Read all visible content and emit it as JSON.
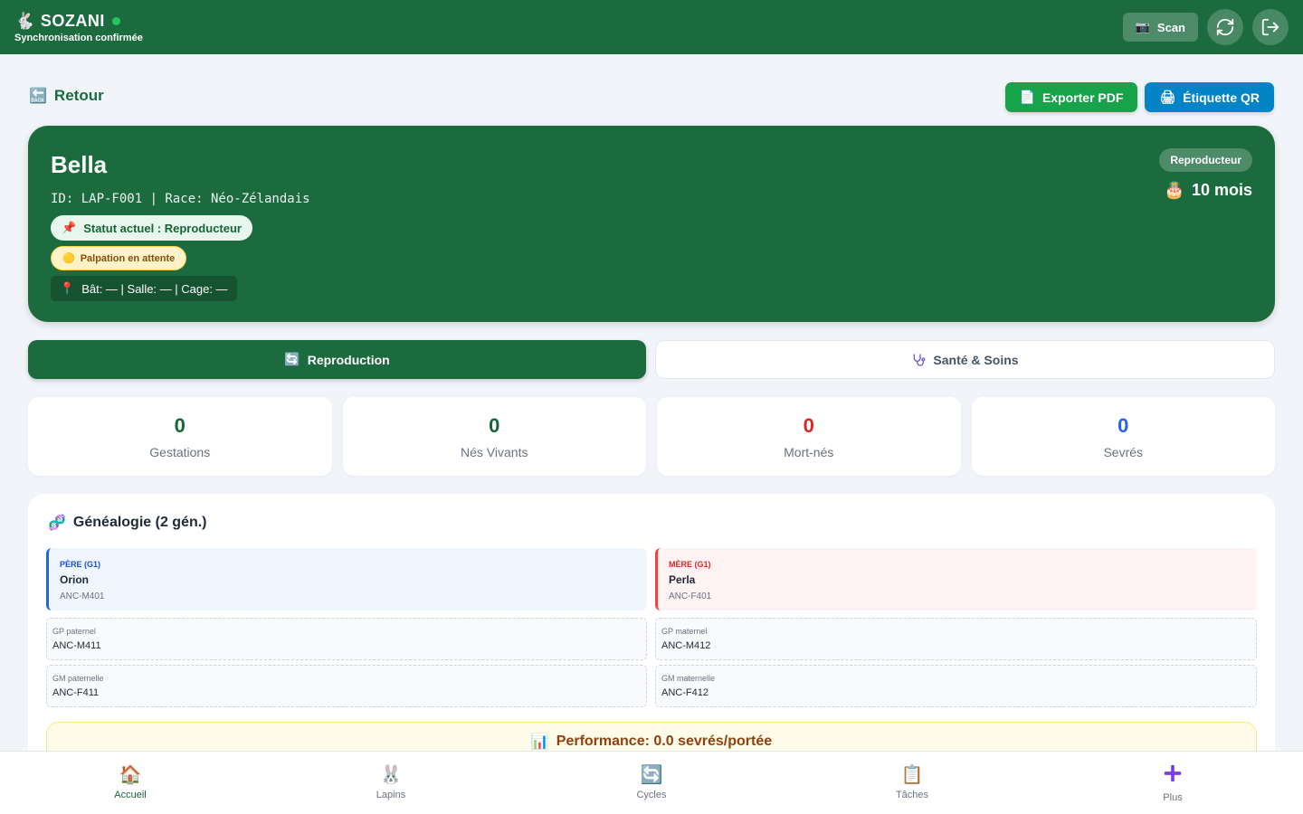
{
  "topbar": {
    "brand": "SOZANI",
    "sync_status": "Synchronisation confirmée",
    "scan_label": "Scan"
  },
  "header": {
    "back_label": "Retour",
    "export_pdf_label": "Exporter PDF",
    "qr_label": "Étiquette QR"
  },
  "animal": {
    "name": "Bella",
    "id_line": "ID: LAP-F001 | Race: Néo-Zélandais",
    "status": "Statut actuel : Reproducteur",
    "palpation": "Palpation en attente",
    "location": "Bât: — | Salle: — | Cage: —",
    "role_badge": "Reproducteur",
    "age": "10 mois"
  },
  "tabs": {
    "reproduction": "Reproduction",
    "sante": "Santé & Soins"
  },
  "stats": [
    {
      "value": "0",
      "label": "Gestations",
      "color": "#166534"
    },
    {
      "value": "0",
      "label": "Nés Vivants",
      "color": "#166534"
    },
    {
      "value": "0",
      "label": "Mort-nés",
      "color": "#dc2626"
    },
    {
      "value": "0",
      "label": "Sevrés",
      "color": "#2563eb"
    }
  ],
  "genealogy": {
    "title": "Généalogie (2 gén.)",
    "father": {
      "role": "PÈRE (G1)",
      "name": "Orion",
      "id": "ANC-M401"
    },
    "mother": {
      "role": "MÈRE (G1)",
      "name": "Perla",
      "id": "ANC-F401"
    },
    "gp_paternel": {
      "role": "GP paternel",
      "id": "ANC-M411"
    },
    "gp_maternel": {
      "role": "GP maternel",
      "id": "ANC-M412"
    },
    "gm_paternelle": {
      "role": "GM paternelle",
      "id": "ANC-F411"
    },
    "gm_maternelle": {
      "role": "GM maternelle",
      "id": "ANC-F412"
    },
    "performance": "Performance: 0.0 sevrés/portée"
  },
  "bottomnav": {
    "items": [
      {
        "label": "Accueil",
        "icon": "home-icon"
      },
      {
        "label": "Lapins",
        "icon": "rabbit-icon"
      },
      {
        "label": "Cycles",
        "icon": "cycle-icon"
      },
      {
        "label": "Tâches",
        "icon": "clipboard-icon"
      },
      {
        "label": "Plus",
        "icon": "plus-icon"
      }
    ]
  }
}
